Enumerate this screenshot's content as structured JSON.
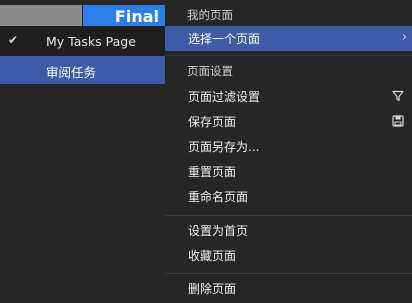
{
  "view_title": "Final",
  "submenu": {
    "items": [
      {
        "label": "My Tasks Page",
        "checked": true
      },
      {
        "label": "审阅任务",
        "highlighted": true
      }
    ]
  },
  "menu": {
    "section_my_pages": "我的页面",
    "select_page": "选择一个页面",
    "section_page_settings": "页面设置",
    "page_filter_settings": "页面过滤设置",
    "save_page": "保存页面",
    "save_page_as": "页面另存为...",
    "reset_page": "重置页面",
    "rename_page": "重命名页面",
    "set_as_home": "设置为首页",
    "favorite_page": "收藏页面",
    "delete_page": "删除页面"
  },
  "colors": {
    "highlight": "#3e5aa7",
    "accent_blue": "#2d7fe8",
    "background": "#262626"
  }
}
